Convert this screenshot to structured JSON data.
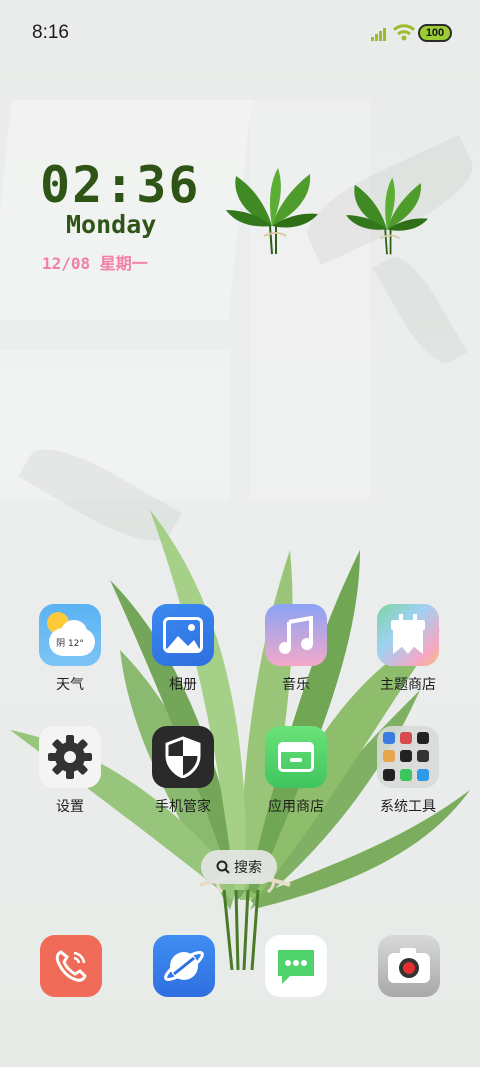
{
  "status_bar": {
    "time": "8:16",
    "battery": "100"
  },
  "widget": {
    "clock": "02:36",
    "weekday": "Monday",
    "date": "12/08 星期一"
  },
  "apps": [
    {
      "label": "天气",
      "icon": "weather-icon",
      "badge": "阴 12°"
    },
    {
      "label": "相册",
      "icon": "gallery-icon"
    },
    {
      "label": "音乐",
      "icon": "music-icon"
    },
    {
      "label": "主题商店",
      "icon": "theme-store-icon"
    },
    {
      "label": "设置",
      "icon": "settings-gear-icon"
    },
    {
      "label": "手机管家",
      "icon": "phone-manager-shield-icon"
    },
    {
      "label": "应用商店",
      "icon": "app-store-icon"
    },
    {
      "label": "系统工具",
      "icon": "system-tools-folder-icon"
    }
  ],
  "search": {
    "label": "搜索"
  },
  "dock": [
    {
      "name": "phone",
      "icon": "phone-icon"
    },
    {
      "name": "browser",
      "icon": "browser-icon"
    },
    {
      "name": "messages",
      "icon": "messages-icon"
    },
    {
      "name": "camera",
      "icon": "camera-icon"
    }
  ]
}
